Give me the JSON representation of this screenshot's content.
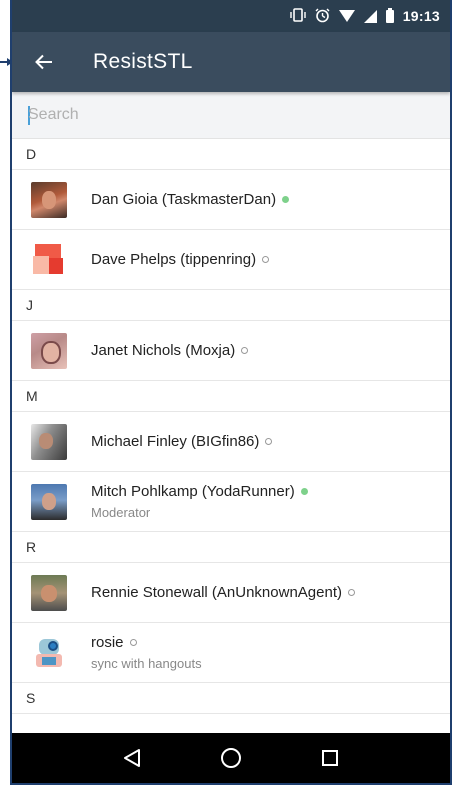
{
  "status_bar": {
    "time": "19:13",
    "icons": [
      "vibrate-icon",
      "alarm-icon",
      "wifi-icon",
      "signal-icon",
      "battery-icon"
    ]
  },
  "app_bar": {
    "title": "ResistSTL",
    "back_icon": "arrow-left-icon"
  },
  "search": {
    "placeholder": "Search",
    "value": ""
  },
  "sections": [
    {
      "letter": "D",
      "members": [
        {
          "name": "Dan Gioia (TaskmasterDan)",
          "status": "online",
          "subtitle": ""
        },
        {
          "name": "Dave Phelps (tippenring)",
          "status": "offline",
          "subtitle": ""
        }
      ]
    },
    {
      "letter": "J",
      "members": [
        {
          "name": "Janet Nichols (Moxja)",
          "status": "offline",
          "subtitle": ""
        }
      ]
    },
    {
      "letter": "M",
      "members": [
        {
          "name": "Michael Finley (BIGfin86)",
          "status": "offline",
          "subtitle": ""
        },
        {
          "name": "Mitch Pohlkamp (YodaRunner)",
          "status": "online",
          "subtitle": "Moderator"
        }
      ]
    },
    {
      "letter": "R",
      "members": [
        {
          "name": "Rennie Stonewall (AnUnknownAgent)",
          "status": "offline",
          "subtitle": ""
        },
        {
          "name": "rosie",
          "status": "offline",
          "subtitle": "sync with hangouts"
        }
      ]
    },
    {
      "letter": "S",
      "members": []
    }
  ],
  "colors": {
    "status_bar": "#2b3e4f",
    "app_bar": "#3a4c5e",
    "online": "#7ed18b",
    "nav_bar": "#000000"
  },
  "nav_bar": {
    "buttons": [
      "back-triangle-icon",
      "home-circle-icon",
      "recents-square-icon"
    ]
  }
}
